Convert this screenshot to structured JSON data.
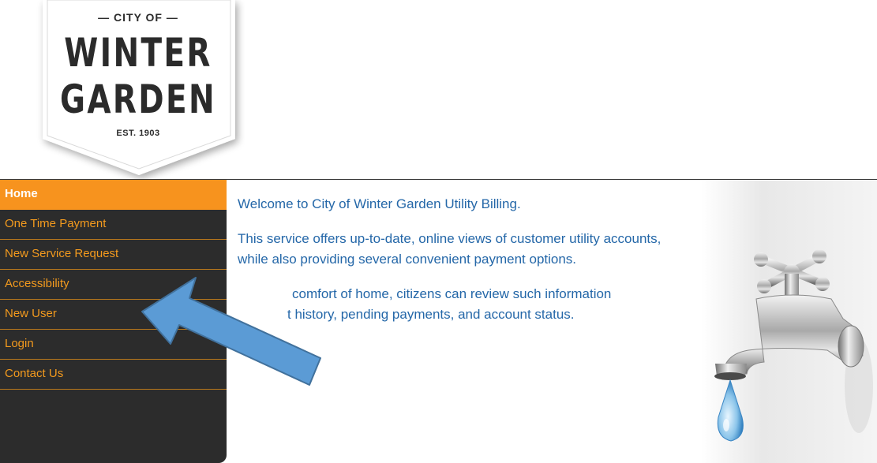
{
  "logo": {
    "top": "— CITY OF —",
    "line1": "WINTER",
    "line2": "GARDEN",
    "est": "EST. 1903"
  },
  "nav": {
    "items": [
      {
        "label": "Home",
        "active": true
      },
      {
        "label": "One Time Payment",
        "active": false
      },
      {
        "label": "New Service Request",
        "active": false
      },
      {
        "label": "Accessibility",
        "active": false
      },
      {
        "label": "New User",
        "active": false
      },
      {
        "label": "Login",
        "active": false
      },
      {
        "label": "Contact Us",
        "active": false
      }
    ]
  },
  "content": {
    "welcome": "Welcome to City of Winter Garden Utility Billing.",
    "para1": "This service offers up-to-date, online views of customer utility accounts, while also providing several convenient payment options.",
    "para2_visible_part1": "comfort of home, citizens can review such information",
    "para2_visible_part2": "t history, pending payments, and account status."
  },
  "colors": {
    "accent": "#f7931e",
    "sidebar_bg": "#2c2c2c",
    "link_text": "#f39a1e",
    "body_text": "#2467a8",
    "arrow_fill": "#5b9bd5",
    "arrow_stroke": "#41719c"
  },
  "icons": {
    "faucet": "faucet-icon",
    "arrow": "annotation-arrow"
  }
}
